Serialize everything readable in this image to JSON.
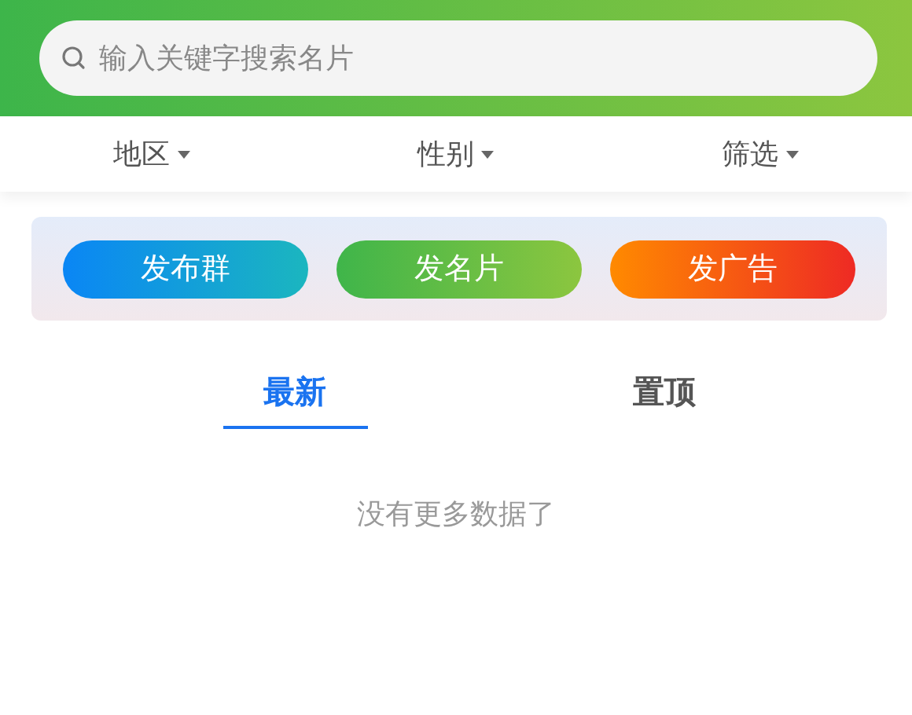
{
  "search": {
    "placeholder": "输入关键字搜索名片"
  },
  "filters": [
    {
      "label": "地区"
    },
    {
      "label": "性别"
    },
    {
      "label": "筛选"
    }
  ],
  "actions": [
    {
      "label": "发布群",
      "kind": "blue"
    },
    {
      "label": "发名片",
      "kind": "green"
    },
    {
      "label": "发广告",
      "kind": "orange"
    }
  ],
  "tabs": [
    {
      "label": "最新",
      "selected": true
    },
    {
      "label": "置顶",
      "selected": false
    }
  ],
  "empty_message": "没有更多数据了"
}
